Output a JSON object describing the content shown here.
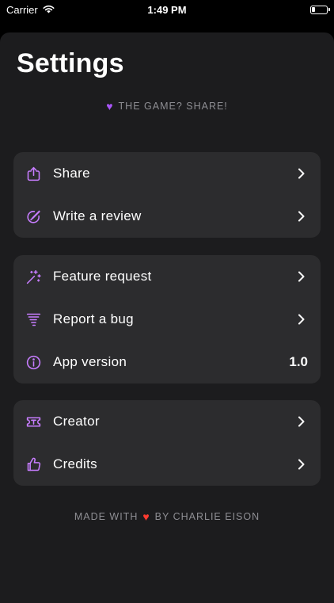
{
  "status_bar": {
    "carrier": "Carrier",
    "time": "1:49 PM"
  },
  "page": {
    "title": "Settings"
  },
  "section_header": {
    "text": "THE GAME? SHARE!"
  },
  "groups": [
    {
      "rows": [
        {
          "label": "Share",
          "icon": "share-icon"
        },
        {
          "label": "Write a review",
          "icon": "edit-icon"
        }
      ]
    },
    {
      "rows": [
        {
          "label": "Feature request",
          "icon": "sparkles-icon"
        },
        {
          "label": "Report a bug",
          "icon": "tornado-icon"
        },
        {
          "label": "App version",
          "icon": "info-icon",
          "value": "1.0"
        }
      ]
    },
    {
      "rows": [
        {
          "label": "Creator",
          "icon": "text-box-icon"
        },
        {
          "label": "Credits",
          "icon": "thumbs-up-icon"
        }
      ]
    }
  ],
  "footer": {
    "prefix": "MADE WITH",
    "suffix": "BY CHARLIE EISON"
  },
  "colors": {
    "accent": "#c77dff",
    "background": "#1c1c1e",
    "row_background": "#2c2c2e",
    "secondary_text": "#8e8e93"
  }
}
